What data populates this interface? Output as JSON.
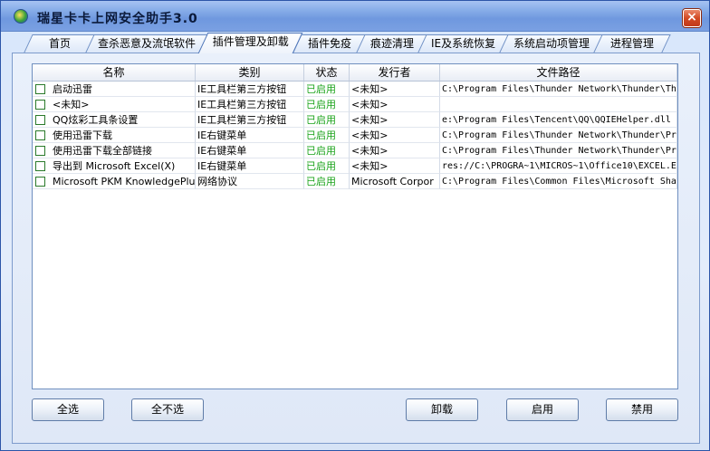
{
  "window": {
    "title": "瑞星卡卡上网安全助手3.0",
    "close_glyph": "×"
  },
  "tabs": [
    {
      "label": "首页"
    },
    {
      "label": "查杀恶意及流氓软件"
    },
    {
      "label": "插件管理及卸载",
      "active": true
    },
    {
      "label": "插件免疫"
    },
    {
      "label": "痕迹清理"
    },
    {
      "label": "IE及系统恢复"
    },
    {
      "label": "系统启动项管理"
    },
    {
      "label": "进程管理"
    }
  ],
  "table": {
    "columns": [
      "名称",
      "类别",
      "状态",
      "发行者",
      "文件路径"
    ],
    "rows": [
      {
        "checked": false,
        "name": "启动迅雷",
        "category": "IE工具栏第三方按钮",
        "status": "已启用",
        "publisher": "<未知>",
        "path": "C:\\Program Files\\Thunder Network\\Thunder\\Th"
      },
      {
        "checked": false,
        "name": "<未知>",
        "category": "IE工具栏第三方按钮",
        "status": "已启用",
        "publisher": "<未知>",
        "path": ""
      },
      {
        "checked": false,
        "name": "QQ炫彩工具条设置",
        "category": "IE工具栏第三方按钮",
        "status": "已启用",
        "publisher": "<未知>",
        "path": "e:\\Program Files\\Tencent\\QQ\\QQIEHelper.dll"
      },
      {
        "checked": false,
        "name": "使用迅雷下载",
        "category": "IE右键菜单",
        "status": "已启用",
        "publisher": "<未知>",
        "path": "C:\\Program Files\\Thunder Network\\Thunder\\Pr"
      },
      {
        "checked": false,
        "name": "使用迅雷下载全部链接",
        "category": "IE右键菜单",
        "status": "已启用",
        "publisher": "<未知>",
        "path": "C:\\Program Files\\Thunder Network\\Thunder\\Pr"
      },
      {
        "checked": false,
        "name": "导出到 Microsoft Excel(X)",
        "category": "IE右键菜单",
        "status": "已启用",
        "publisher": "<未知>",
        "path": "res://C:\\PROGRA~1\\MICROS~1\\Office10\\EXCEL.E"
      },
      {
        "checked": false,
        "name": "Microsoft PKM KnowledgePlu",
        "category": "网络协议",
        "status": "已启用",
        "publisher": "Microsoft Corpor",
        "path": "C:\\Program Files\\Common Files\\Microsoft Sha"
      }
    ]
  },
  "buttons": {
    "select_all": "全选",
    "select_none": "全不选",
    "uninstall": "卸载",
    "enable": "启用",
    "disable": "禁用"
  },
  "colors": {
    "status_enabled": "#1aa31a",
    "title_bar": "#88aee9",
    "close_button": "#d24a24"
  }
}
